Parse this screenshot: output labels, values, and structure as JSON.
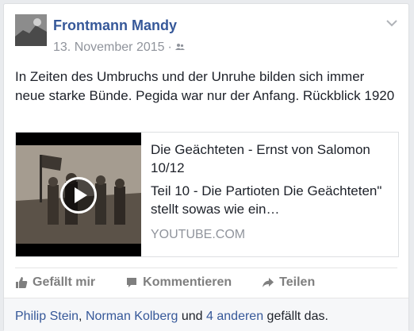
{
  "post": {
    "author": "Frontmann Mandy",
    "date": "13. November 2015",
    "separator": "·",
    "audience_icon": "friends-icon",
    "text": "In Zeiten des Umbruchs und der Unruhe bilden sich immer neue starke Bünde. Pegida war nur der Anfang. Rückblick 1920"
  },
  "share": {
    "title": "Die Geächteten - Ernst von Salomon 10/12",
    "description": "Teil 10 - Die Partioten Die Geächteten\" stellt sowas wie ein…",
    "domain": "YOUTUBE.COM",
    "thumbnail_icon": "play-icon"
  },
  "actions": {
    "like": "Gefällt mir",
    "comment": "Kommentieren",
    "share": "Teilen"
  },
  "likes": {
    "user1": "Philip Stein",
    "comma": ", ",
    "user2": "Norman Kolberg",
    "and": " und ",
    "others": "4 anderen",
    "suffix": " gefällt das."
  },
  "colors": {
    "link": "#365899",
    "muted": "#90949c",
    "action": "#7f7f7f"
  }
}
